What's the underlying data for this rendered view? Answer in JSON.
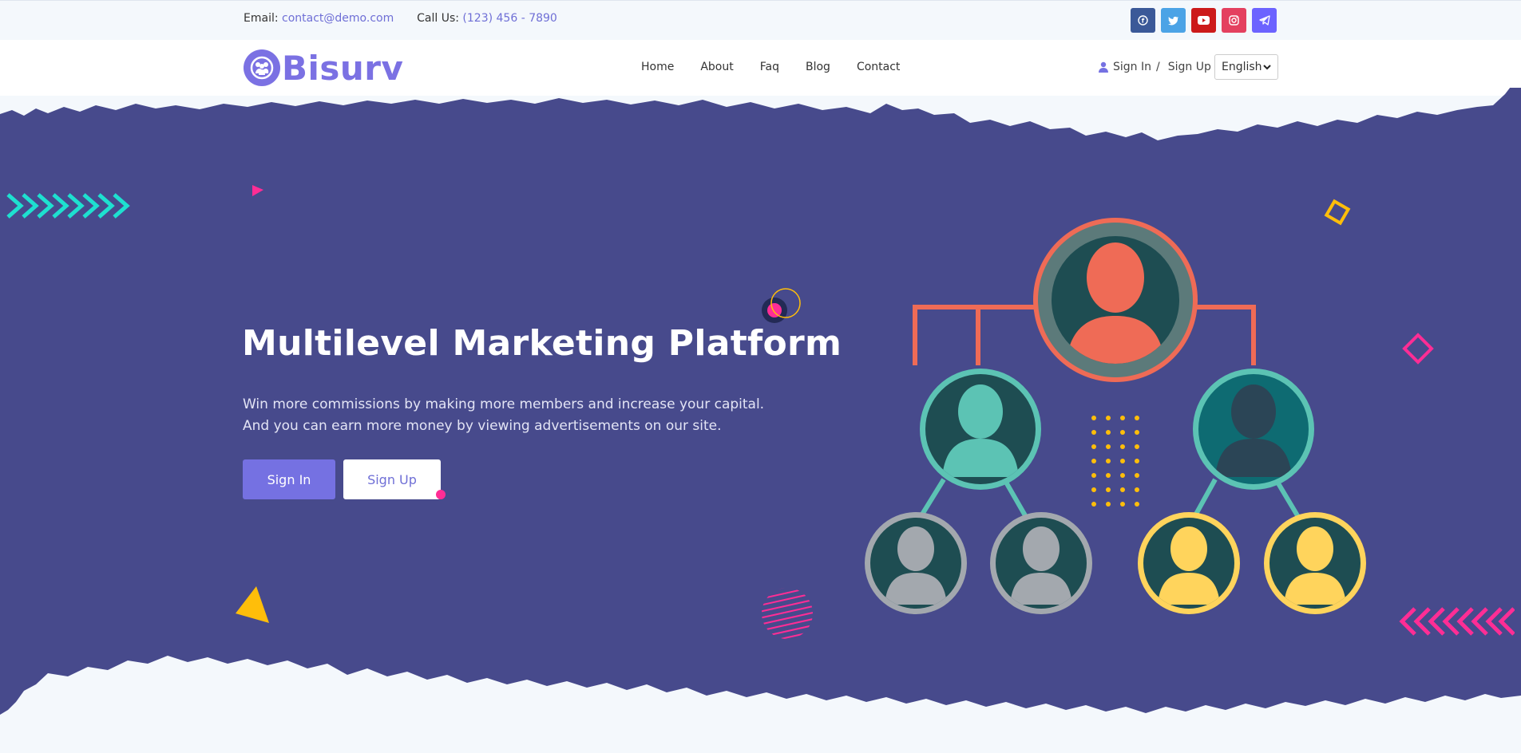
{
  "topbar": {
    "email_label": "Email:",
    "email_value": "contact@demo.com",
    "phone_label": "Call Us:",
    "phone_value": "(123) 456 - 7890",
    "socials": [
      {
        "name": "facebook-icon",
        "color": "#3b5998",
        "glyph": "f"
      },
      {
        "name": "twitter-icon",
        "color": "#4ba3e6",
        "glyph": "t"
      },
      {
        "name": "youtube-icon",
        "color": "#cc1a1a",
        "glyph": "▶"
      },
      {
        "name": "instagram-icon",
        "color": "#e4405f",
        "glyph": "◎"
      },
      {
        "name": "telegram-icon",
        "color": "#6c63ff",
        "glyph": "✈"
      }
    ]
  },
  "nav": {
    "logo_text": "Bisurv",
    "menu": [
      "Home",
      "About",
      "Faq",
      "Blog",
      "Contact"
    ],
    "sign_in": "Sign In",
    "separator": "/",
    "sign_up": "Sign Up",
    "language": "English"
  },
  "hero": {
    "title": "Multilevel Marketing Platform",
    "description": "Win more commissions by making more members and increase your capital. And you can earn more money by viewing advertisements on our site.",
    "btn_sign_in": "Sign In",
    "btn_sign_up": "Sign Up"
  },
  "colors": {
    "hero_bg": "#474a8c",
    "accent": "#7571e2",
    "teal": "#1ee0d0",
    "pink": "#ff2d95",
    "yellow": "#ffbe0a"
  }
}
